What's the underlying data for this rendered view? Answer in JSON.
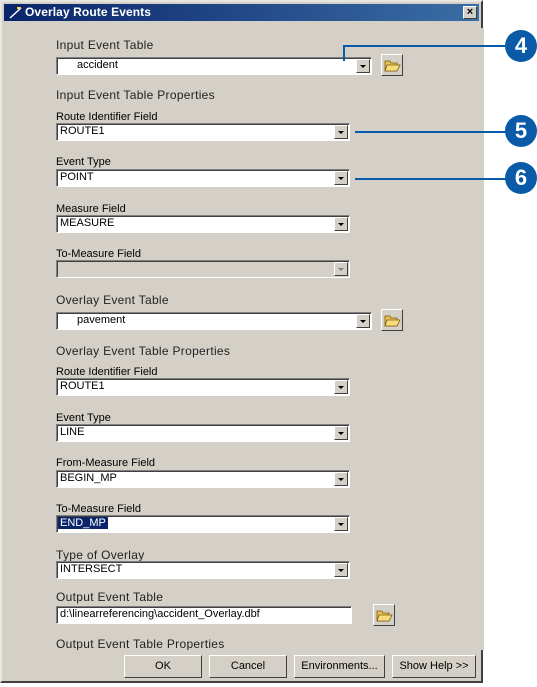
{
  "window": {
    "title": "Overlay Route Events",
    "close_label": "×"
  },
  "fields": {
    "input_event_table": {
      "label": "Input Event Table",
      "value": "accident"
    },
    "input_props_header": "Input Event Table Properties",
    "input_route_id": {
      "label": "Route Identifier Field",
      "value": "ROUTE1"
    },
    "input_event_type": {
      "label": "Event Type",
      "value": "POINT"
    },
    "input_measure": {
      "label": "Measure Field",
      "value": "MEASURE"
    },
    "input_to_measure": {
      "label": "To-Measure Field",
      "value": ""
    },
    "overlay_event_table": {
      "label": "Overlay Event Table",
      "value": "pavement"
    },
    "overlay_props_header": "Overlay Event Table Properties",
    "overlay_route_id": {
      "label": "Route Identifier Field",
      "value": "ROUTE1"
    },
    "overlay_event_type": {
      "label": "Event Type",
      "value": "LINE"
    },
    "overlay_from_measure": {
      "label": "From-Measure Field",
      "value": "BEGIN_MP"
    },
    "overlay_to_measure": {
      "label": "To-Measure Field",
      "value": "END_MP"
    },
    "type_of_overlay": {
      "label": "Type of Overlay",
      "value": "INTERSECT"
    },
    "output_event_table": {
      "label": "Output Event Table",
      "value": "d:\\linearreferencing\\accident_Overlay.dbf"
    },
    "output_props_header": "Output Event Table Properties"
  },
  "buttons": {
    "ok": "OK",
    "cancel": "Cancel",
    "environments": "Environments...",
    "show_help": "Show Help >>"
  },
  "callouts": {
    "c4": "4",
    "c5": "5",
    "c6": "6"
  },
  "colors": {
    "title_bar": "#0a246a",
    "callout": "#0a5aa8",
    "dialog_face": "#d4d0c8"
  },
  "icons": {
    "title": "route-tool-icon",
    "browse": "open-folder-icon"
  }
}
